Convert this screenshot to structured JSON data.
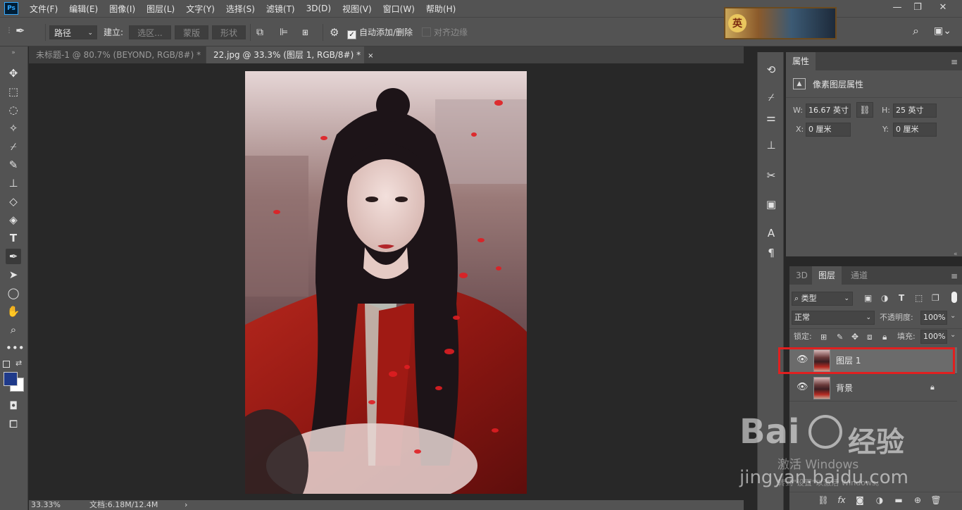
{
  "app": {
    "logo": "Ps",
    "menu": [
      "文件(F)",
      "编辑(E)",
      "图像(I)",
      "图层(L)",
      "文字(Y)",
      "选择(S)",
      "滤镜(T)",
      "3D(D)",
      "视图(V)",
      "窗口(W)",
      "帮助(H)"
    ],
    "banner_char": "英",
    "window_buttons": {
      "minimize": "—",
      "restore": "❐",
      "close": "✕"
    }
  },
  "options": {
    "mode": "路径",
    "build_label": "建立:",
    "selection_btn": "选区...",
    "mask_btn": "蒙版",
    "shape_btn": "形状",
    "auto_add_delete": "自动添加/删除",
    "align_edges": "对齐边缘"
  },
  "tabs": [
    {
      "title": "未标题-1 @ 80.7% (BEYOND, RGB/8#) *",
      "close": "×"
    },
    {
      "title": "22.jpg @ 33.3% (图层 1, RGB/8#) *",
      "close": "×"
    }
  ],
  "status": {
    "zoom": "33.33%",
    "doc": "文档:6.18M/12.4M",
    "arrow": "›"
  },
  "properties": {
    "tab": "属性",
    "section": "像素图层属性",
    "w_label": "W:",
    "w": "16.67 英寸",
    "h_label": "H:",
    "h": "25 英寸",
    "x_label": "X:",
    "x": "0 厘米",
    "y_label": "Y:",
    "y": "0 厘米"
  },
  "layers_panel": {
    "tabs": [
      "3D",
      "图层",
      "通道"
    ],
    "filter": "类型",
    "blend_mode": "正常",
    "opacity_label": "不透明度:",
    "opacity": "100%",
    "lock_label": "锁定:",
    "fill_label": "填充:",
    "fill": "100%",
    "layers": [
      {
        "name": "图层 1",
        "selected": true,
        "locked": false
      },
      {
        "name": "背景",
        "selected": false,
        "locked": true
      }
    ]
  },
  "watermark": {
    "brand_left": "Bai",
    "brand_right": "经验",
    "url": "jingyan.baidu.com",
    "activate": "激活 Windows",
    "activate_sub": "转到\"设置\"以激活 Windows。"
  },
  "colors": {
    "foreground": "#1f3a8a",
    "background": "#ffffff",
    "selection_outline": "#e02020"
  }
}
